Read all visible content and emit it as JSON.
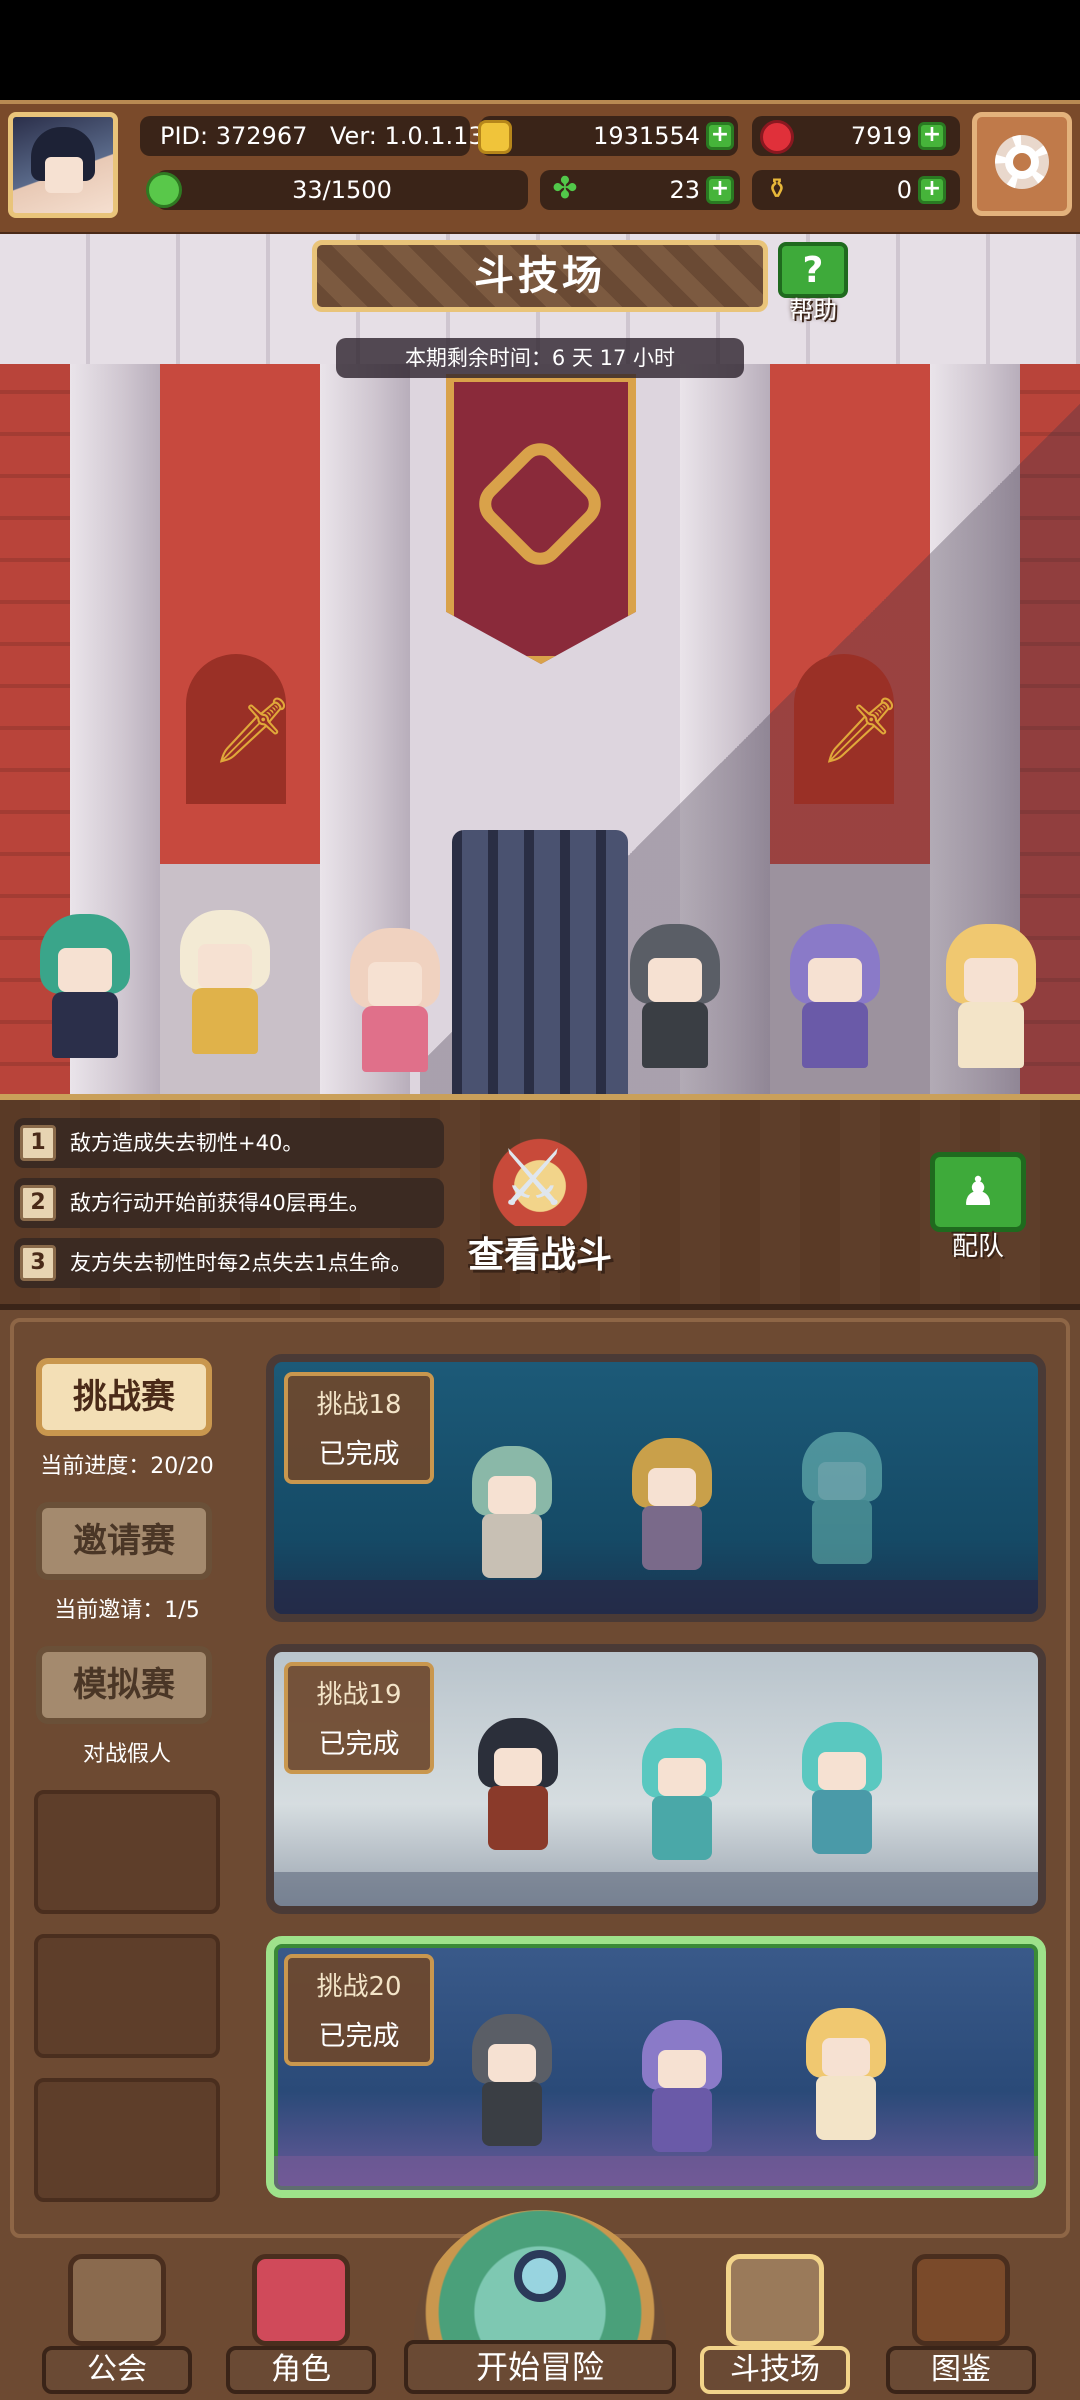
{
  "hud": {
    "pid": "PID: 372967",
    "version": "Ver: 1.0.1.13",
    "gold": "1931554",
    "gems": "7919",
    "stamina": "33/1500",
    "clover": "23",
    "potion": "0",
    "plus_symbol": "+"
  },
  "arena": {
    "title": "斗技场",
    "help_label": "帮助",
    "help_symbol": "?",
    "timer": "本期剩余时间：6 天 17 小时"
  },
  "modifiers": [
    {
      "num": "1",
      "text": "敌方造成失去韧性+40。"
    },
    {
      "num": "2",
      "text": "敌方行动开始前获得40层再生。"
    },
    {
      "num": "3",
      "text": "友方失去韧性时每2点失去1点生命。"
    }
  ],
  "view_battle_label": "查看战斗",
  "team_label": "配队",
  "sidebar": {
    "challenge_label": "挑战赛",
    "challenge_progress": "当前进度：20/20",
    "invite_label": "邀请赛",
    "invite_progress": "当前邀请：1/5",
    "sim_label": "模拟赛",
    "sim_sub": "对战假人"
  },
  "challenges": [
    {
      "title": "挑战18",
      "status": "已完成"
    },
    {
      "title": "挑战19",
      "status": "已完成"
    },
    {
      "title": "挑战20",
      "status": "已完成"
    }
  ],
  "nav": {
    "guild": "公会",
    "character": "角色",
    "adventure": "开始冒险",
    "arena": "斗技场",
    "codex": "图鉴"
  },
  "colors": {
    "accent_gold": "#e9c47a",
    "panel_brown": "#6d4a32",
    "selected_green": "#9ee28a",
    "plus_green": "#46b43a"
  }
}
